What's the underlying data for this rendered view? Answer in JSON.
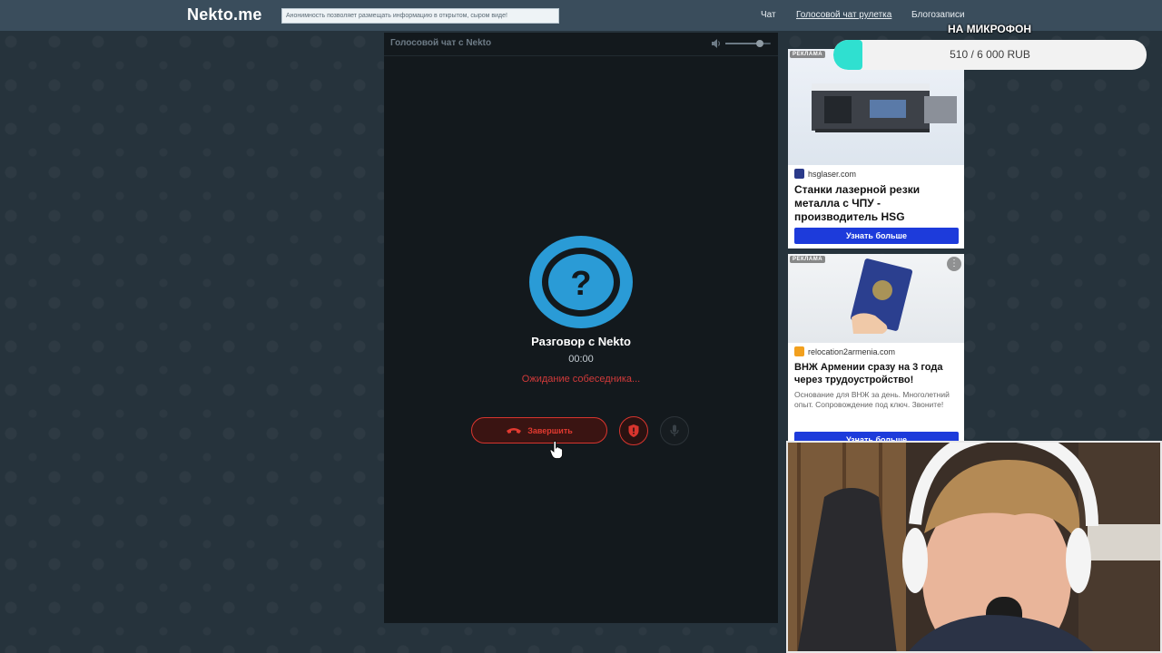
{
  "header": {
    "logo": "Nekto.me",
    "notice": "Анонимность позволяет размещать информацию в открытом, сыром виде!",
    "nav": [
      {
        "label": "Чат"
      },
      {
        "label": "Голосовой чат рулетка"
      },
      {
        "label": "Блогозаписи"
      }
    ]
  },
  "chat": {
    "title": "Голосовой чат с Nekto",
    "volume_level": 0.75,
    "avatar_symbol": "?",
    "conversation_title": "Разговор с Nekto",
    "timer": "00:00",
    "status": "Ожидание собеседника...",
    "end_label": "Завершить"
  },
  "ads": [
    {
      "label": "РЕКЛАМА",
      "domain": "hsglaser.com",
      "title": "Станки лазерной резки металла с ЧПУ - производитель HSG",
      "cta": "Узнать больше"
    },
    {
      "label": "РЕКЛАМА",
      "domain": "relocation2armenia.com",
      "title": "ВНЖ Армении сразу на 3 года через трудоустройство!",
      "description": "Основание для ВНЖ за день. Многолетний опыт. Сопровождение под ключ. Звоните!",
      "cta": "Узнать больше"
    }
  ],
  "donation": {
    "title": "НА МИКРОФОН",
    "progress_text": "510 / 6 000 RUB",
    "progress": 0.085
  },
  "colors": {
    "nav_bg": "#3a4d5c",
    "page_bg": "#26333c",
    "panel_bg": "#13191d",
    "avatar_blue": "#2a9bd6",
    "danger_red": "#d8352e",
    "donate_fill": "#2fe0d0",
    "ad_cta": "#1d3bdb"
  }
}
